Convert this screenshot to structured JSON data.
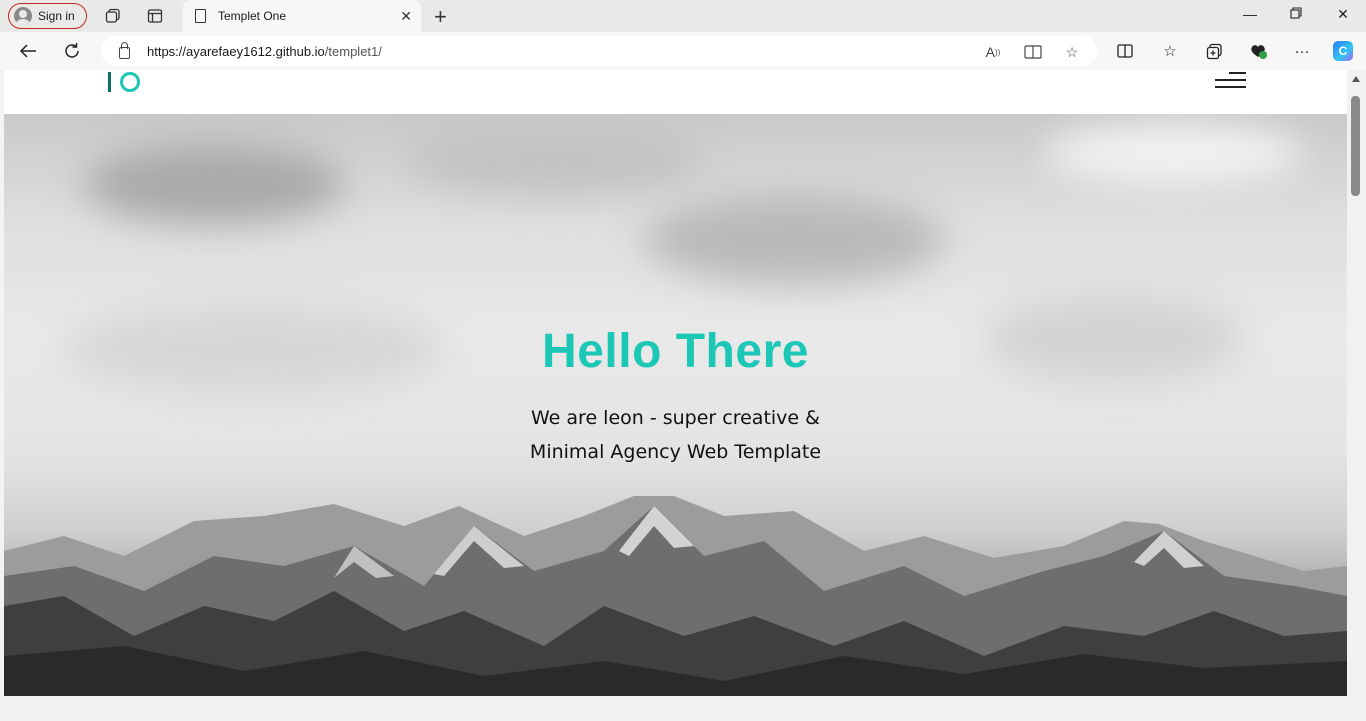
{
  "browser": {
    "signin_label": "Sign in",
    "tab_title": "Templet One",
    "url_host": "https://ayarefaey1612.github.io",
    "url_path": "/templet1/"
  },
  "site": {
    "hero_title": "Hello There",
    "hero_line1": "We are leon - super creative &",
    "hero_line2": "Minimal Agency Web Template"
  },
  "colors": {
    "accent": "#1cc7b6",
    "logo_dark": "#0d6f6a",
    "signin_border": "#c42b1c"
  }
}
